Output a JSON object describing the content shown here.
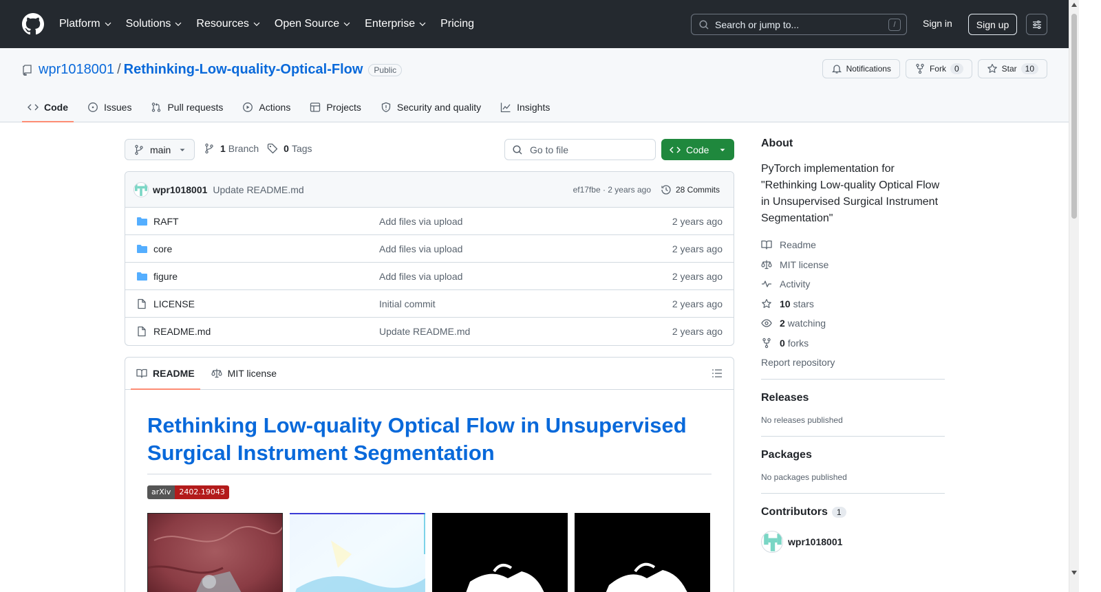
{
  "header": {
    "nav": [
      "Platform",
      "Solutions",
      "Resources",
      "Open Source",
      "Enterprise",
      "Pricing"
    ],
    "search_placeholder": "Search or jump to...",
    "search_shortcut": "/",
    "sign_in": "Sign in",
    "sign_up": "Sign up"
  },
  "repo": {
    "owner": "wpr1018001",
    "separator": "/",
    "name": "Rethinking-Low-quality-Optical-Flow",
    "visibility": "Public",
    "notifications_label": "Notifications",
    "fork_label": "Fork",
    "fork_count": "0",
    "star_label": "Star",
    "star_count": "10"
  },
  "tabs": [
    "Code",
    "Issues",
    "Pull requests",
    "Actions",
    "Projects",
    "Security and quality",
    "Insights"
  ],
  "toolbar": {
    "branch": "main",
    "branch_count": "1",
    "branch_label": "Branch",
    "tag_count": "0",
    "tag_label": "Tags",
    "goto_placeholder": "Go to file",
    "code_button": "Code"
  },
  "commit": {
    "author": "wpr1018001",
    "message": "Update README.md",
    "sha_age": "ef17fbe · 2 years ago",
    "commits": "28 Commits"
  },
  "files": [
    {
      "name": "RAFT",
      "type": "folder",
      "message": "Add files via upload",
      "age": "2 years ago"
    },
    {
      "name": "core",
      "type": "folder",
      "message": "Add files via upload",
      "age": "2 years ago"
    },
    {
      "name": "figure",
      "type": "folder",
      "message": "Add files via upload",
      "age": "2 years ago"
    },
    {
      "name": "LICENSE",
      "type": "file",
      "message": "Initial commit",
      "age": "2 years ago"
    },
    {
      "name": "README.md",
      "type": "file",
      "message": "Update README.md",
      "age": "2 years ago"
    }
  ],
  "readme": {
    "tab_readme": "README",
    "tab_license": "MIT license",
    "title": "Rethinking Low-quality Optical Flow in Unsupervised Surgical Instrument Segmentation",
    "badge_left": "arXiv",
    "badge_right": "2402.19043"
  },
  "sidebar": {
    "about_title": "About",
    "description": "PyTorch implementation for \"Rethinking Low-quality Optical Flow in Unsupervised Surgical Instrument Segmentation\"",
    "readme": "Readme",
    "license": "MIT license",
    "activity": "Activity",
    "stars_count": "10",
    "stars_label": "stars",
    "watching_count": "2",
    "watching_label": "watching",
    "forks_count": "0",
    "forks_label": "forks",
    "report": "Report repository",
    "releases_title": "Releases",
    "releases_empty": "No releases published",
    "packages_title": "Packages",
    "packages_empty": "No packages published",
    "contributors_title": "Contributors",
    "contributors_count": "1",
    "contributor_name": "wpr1018001"
  },
  "colors": {
    "header_bg": "#24292f",
    "link": "#0969da",
    "code_button": "#1f883d",
    "tab_underline": "#fd8c73",
    "folder_icon": "#54aeff"
  }
}
